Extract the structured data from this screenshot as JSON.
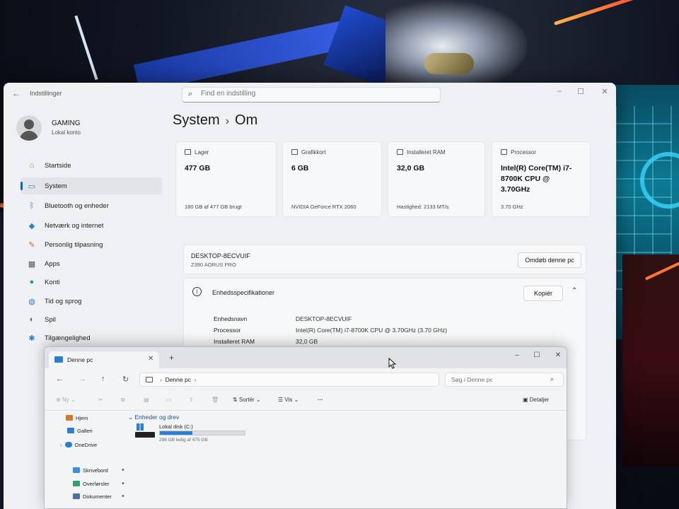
{
  "settings": {
    "app_title": "Indstillinger",
    "search_placeholder": "Find en indstilling",
    "profile": {
      "name": "GAMING",
      "sub": "Lokal konto"
    },
    "nav": [
      {
        "label": "Startside",
        "icon": "home-icon"
      },
      {
        "label": "System",
        "icon": "monitor-icon",
        "active": true
      },
      {
        "label": "Bluetooth og enheder",
        "icon": "bluetooth-icon"
      },
      {
        "label": "Netværk og internet",
        "icon": "wifi-icon"
      },
      {
        "label": "Personlig tilpasning",
        "icon": "brush-icon"
      },
      {
        "label": "Apps",
        "icon": "apps-icon"
      },
      {
        "label": "Konti",
        "icon": "person-icon"
      },
      {
        "label": "Tid og sprog",
        "icon": "globe-icon"
      },
      {
        "label": "Spil",
        "icon": "gamepad-icon"
      },
      {
        "label": "Tilgængelighed",
        "icon": "accessibility-icon"
      }
    ],
    "breadcrumb": {
      "parent": "System",
      "sep": "›",
      "current": "Om"
    },
    "cards": [
      {
        "label": "Lager",
        "value": "477 GB",
        "sub": "180 GB af 477 GB brugt"
      },
      {
        "label": "Grafikkort",
        "value": "6 GB",
        "sub": "NVIDIA GeForce RTX 2060"
      },
      {
        "label": "Installeret RAM",
        "value": "32,0 GB",
        "sub": "Hastighed: 2133 MT/s"
      },
      {
        "label": "Processor",
        "value": "Intel(R) Core(TM) i7-8700K CPU @ 3.70GHz",
        "sub": "3.70 GHz"
      }
    ],
    "device": {
      "name": "DESKTOP-8ECVUIF",
      "model": "Z390 AORUS PRO",
      "rename_label": "Omdøb denne pc"
    },
    "specs": {
      "title": "Enhedsspecifikationer",
      "copy_label": "Kopiér",
      "rows": [
        {
          "key": "Enhedsnavn",
          "value": "DESKTOP-8ECVUIF"
        },
        {
          "key": "Processor",
          "value": "Intel(R) Core(TM) i7-8700K CPU @ 3.70GHz (3.70 GHz)"
        },
        {
          "key": "Installeret RAM",
          "value": "32,0 GB"
        }
      ]
    }
  },
  "explorer": {
    "tab_label": "Denne pc",
    "path": "Denne pc",
    "search_placeholder": "Søg i Denne pc",
    "toolbar": {
      "new": "Ny",
      "sort": "Sortér",
      "view": "Vis",
      "more": "···",
      "details": "Detaljer"
    },
    "sidebar": [
      {
        "label": "Hjem",
        "icon": "home-icon"
      },
      {
        "label": "Galleri",
        "icon": "gallery-icon"
      },
      {
        "label": "OneDrive",
        "icon": "cloud-icon"
      },
      {
        "label": "Skrivebord",
        "icon": "desktop-icon"
      },
      {
        "label": "Overførsler",
        "icon": "download-icon"
      },
      {
        "label": "Dokumenter",
        "icon": "document-icon"
      }
    ],
    "group_title": "Enheder og drev",
    "drive": {
      "name": "Lokal disk (C:)",
      "free_text": "296 GB ledig af 475 GB",
      "used_fraction": 0.38
    }
  },
  "colors": {
    "accent": "#0067c0",
    "drive_bar": "#2a7fd4"
  }
}
